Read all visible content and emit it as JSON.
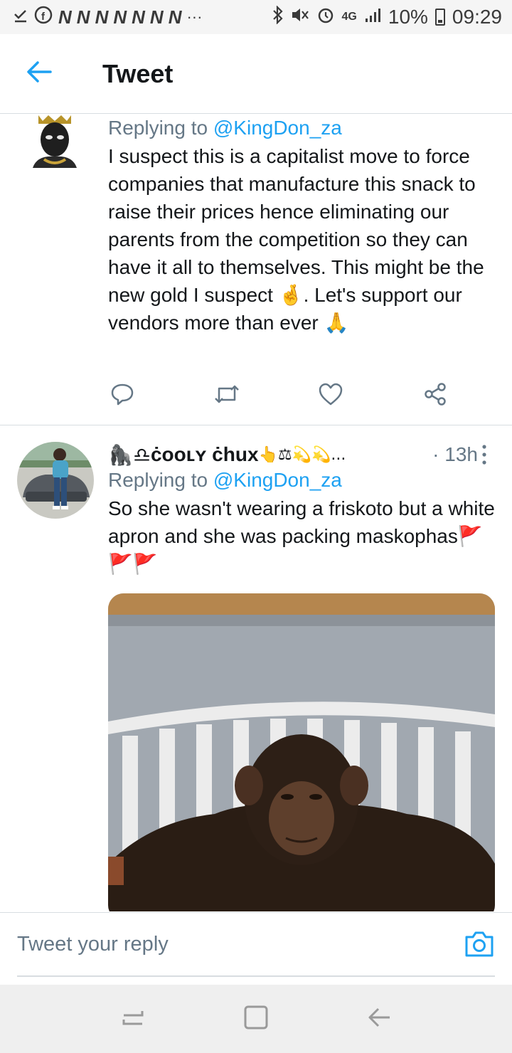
{
  "status_bar": {
    "left_icons": [
      "download-done-icon",
      "facebook-icon"
    ],
    "notification_letters": [
      "N",
      "N",
      "N",
      "N",
      "N",
      "N",
      "N"
    ],
    "more": "···",
    "network": "4G",
    "battery": "10%",
    "time": "09:29"
  },
  "header": {
    "title": "Tweet"
  },
  "tweets": [
    {
      "reply_prefix": "Replying to ",
      "reply_handle": "@KingDon_za",
      "text_1": "I suspect this is a capitalist move to force companies that manufacture this snack to raise their prices hence eliminating our parents from the competition so they can have it all to themselves. This might be the new gold I suspect ",
      "emoji_1": "🤞",
      "text_2": ". Let's support our vendors more than ever ",
      "emoji_2": "🙏"
    },
    {
      "name_prefix_emoji": "🦍♎",
      "name": "ċooʟʏ ċһux",
      "name_suffix_emoji": "👆⚖💫💫...",
      "time": "· 13h",
      "reply_prefix": "Replying to ",
      "reply_handle": "@KingDon_za",
      "text": "So she wasn't wearing a friskoto but a white apron and she was packing maskophas",
      "text_emoji": "🚩🚩🚩"
    }
  ],
  "composer": {
    "placeholder": "Tweet your reply"
  },
  "colors": {
    "accent": "#1da1f2",
    "secondary_text": "#657786",
    "divider": "#d8dde1"
  }
}
